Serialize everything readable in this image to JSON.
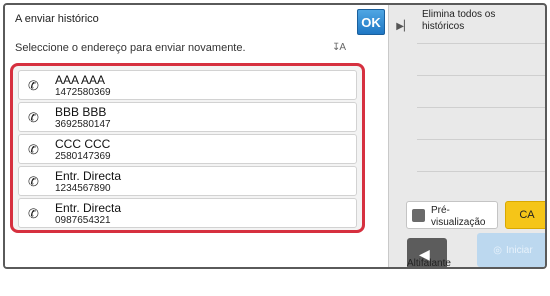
{
  "header": {
    "title": "A enviar histórico",
    "hint": "Seleccione o endereço para enviar novamente.",
    "ok_label": "OK"
  },
  "history": [
    {
      "name": "AAA AAA",
      "number": "1472580369"
    },
    {
      "name": "BBB BBB",
      "number": "3692580147"
    },
    {
      "name": "CCC CCC",
      "number": "2580147369"
    },
    {
      "name": "Entr. Directa",
      "number": "1234567890"
    },
    {
      "name": "Entr. Directa",
      "number": "0987654321"
    }
  ],
  "side": {
    "clear_all_label": "Elimina todos os históricos",
    "preview_label": "Pré-visualização",
    "ca_label": "CA",
    "speaker_label": "Altifalante",
    "start_label": "Iniciar"
  },
  "colors": {
    "ok": "#1f77c4",
    "list_border": "#d6303f",
    "ca": "#f5c518",
    "start": "#bcd8ef"
  }
}
